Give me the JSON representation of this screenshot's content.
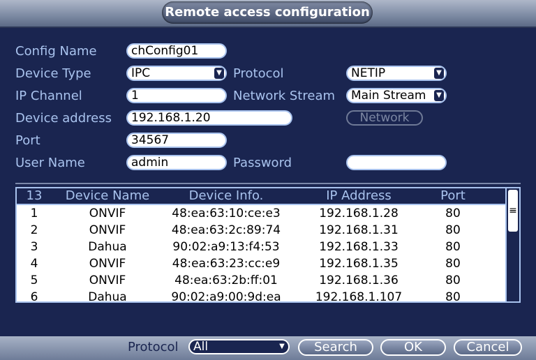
{
  "window": {
    "title": "Remote access configuration"
  },
  "form": {
    "config_name_label": "Config Name",
    "config_name_value": "chConfig01",
    "device_type_label": "Device Type",
    "device_type_value": "IPC",
    "protocol_label": "Protocol",
    "protocol_value": "NETIP",
    "ip_channel_label": "IP Channel",
    "ip_channel_value": "1",
    "network_stream_label": "Network Stream",
    "network_stream_value": "Main Stream",
    "device_address_label": "Device address",
    "device_address_value": "192.168.1.20",
    "network_button": "Network",
    "port_label": "Port",
    "port_value": "34567",
    "user_name_label": "User Name",
    "user_name_value": "admin",
    "password_label": "Password",
    "password_value": ""
  },
  "device_list": {
    "count": "13",
    "headers": [
      "Device Name",
      "Device Info.",
      "IP Address",
      "Port"
    ],
    "rows": [
      {
        "idx": "1",
        "name": "ONVIF",
        "info": "48:ea:63:10:ce:e3",
        "ip": "192.168.1.28",
        "port": "80"
      },
      {
        "idx": "2",
        "name": "ONVIF",
        "info": "48:ea:63:2c:89:74",
        "ip": "192.168.1.31",
        "port": "80"
      },
      {
        "idx": "3",
        "name": "Dahua",
        "info": "90:02:a9:13:f4:53",
        "ip": "192.168.1.33",
        "port": "80"
      },
      {
        "idx": "4",
        "name": "ONVIF",
        "info": "48:ea:63:23:cc:e9",
        "ip": "192.168.1.35",
        "port": "80"
      },
      {
        "idx": "5",
        "name": "ONVIF",
        "info": "48:ea:63:2b:ff:01",
        "ip": "192.168.1.36",
        "port": "80"
      },
      {
        "idx": "6",
        "name": "Dahua",
        "info": "90:02:a9:00:9d:ea",
        "ip": "192.168.1.107",
        "port": "80"
      }
    ]
  },
  "bottom": {
    "protocol_label": "Protocol",
    "protocol_value": "All",
    "search_button": "Search",
    "ok_button": "OK",
    "cancel_button": "Cancel"
  },
  "icons": {
    "select_arrow": "chevron-down-icon",
    "scroll_grip": "scroll-grip-icon"
  },
  "colors": {
    "panel": "#1a2550",
    "label": "#a9c3ee",
    "field_bg": "#ffffff"
  }
}
